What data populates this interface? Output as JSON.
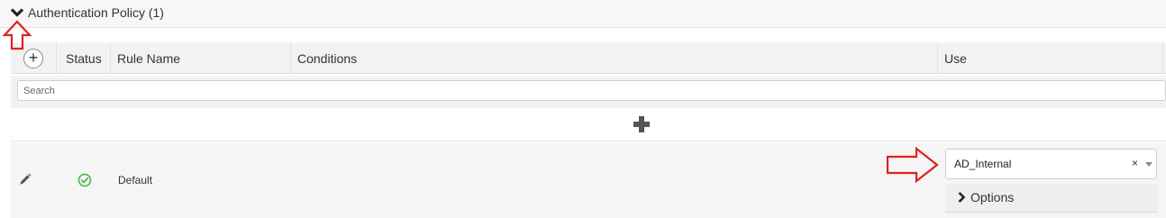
{
  "section": {
    "title": "Authentication Policy (1)",
    "chevron_icon": "chevron-down-icon"
  },
  "table": {
    "columns": {
      "add_symbol": "+",
      "status": "Status",
      "rule_name": "Rule Name",
      "conditions": "Conditions",
      "use": "Use"
    },
    "search_placeholder": "Search",
    "add_rule_icon": "plus-icon"
  },
  "rows": [
    {
      "edit_icon": "pencil-icon",
      "status_icon": "check-circle-icon",
      "status_color": "#5cb85c",
      "rule_name": "Default",
      "use": {
        "selected": "AD_Internal",
        "clear_symbol": "×"
      },
      "options_label": "Options"
    }
  ],
  "annotations": {
    "arrow_color": "#e02020"
  }
}
